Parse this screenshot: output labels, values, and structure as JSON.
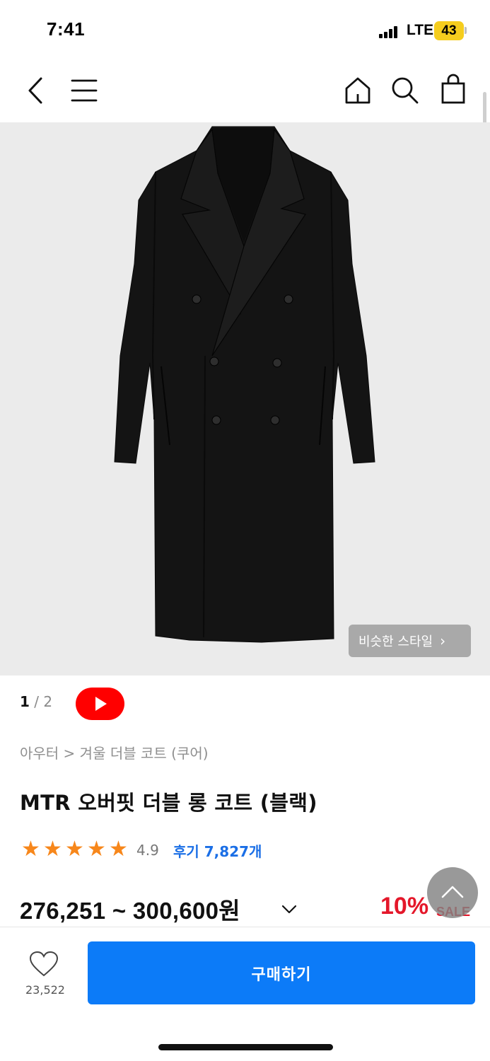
{
  "status_bar": {
    "time": "7:41",
    "network": "LTE",
    "battery": "43"
  },
  "nav": {
    "icons": [
      "back-icon",
      "menu-icon",
      "home-icon",
      "search-icon",
      "shopping-bag-icon"
    ]
  },
  "gallery": {
    "current_page": "1",
    "separator": " / ",
    "total_pages": "2",
    "similar_style_label": "비슷한 스타일",
    "similar_style_chevron": "›",
    "video_icon": "youtube-play-icon"
  },
  "product": {
    "breadcrumb": "아우터 > 겨울 더블 코트 (쿠어)",
    "title": "MTR 오버핏 더블 롱 코트 (블랙)",
    "rating_stars": 5,
    "rating": "4.9",
    "reviews": "후기 7,827개",
    "price": "276,251 ~ 300,600원",
    "discount": "10%",
    "sale_label": "SALE"
  },
  "colors": {
    "accent": "#0c7bf8",
    "sale_red": "#e4172a",
    "star": "#f7871b",
    "youtube": "#ff0000",
    "battery": "#f5cd1e"
  },
  "bottom_bar": {
    "like_count": "23,522",
    "buy_label": "구매하기"
  }
}
